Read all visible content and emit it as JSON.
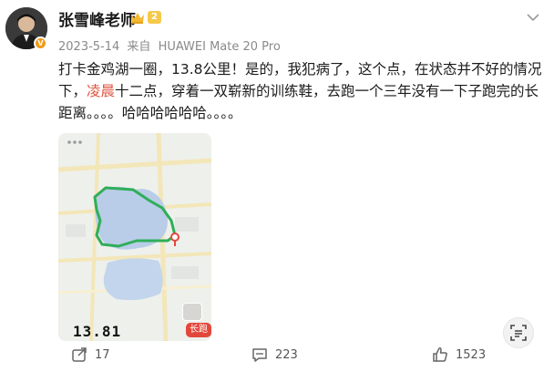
{
  "author": {
    "name": "张雪峰老师",
    "level_badge": "2"
  },
  "meta": {
    "date": "2023-5-14",
    "source_prefix": "来自",
    "device": "HUAWEI Mate 20 Pro"
  },
  "post": {
    "text_before_highlight": "打卡金鸡湖一圈，13.8公里！是的，我犯病了，这个点，在状态并不好的情况下，",
    "highlight": "凌晨",
    "text_after_highlight": "十二点，穿着一双崭新的训练鞋，去跑一个三年没有一下子跑完的长距离。。。。哈哈哈哈哈哈。。。。"
  },
  "map_card": {
    "distance": "13.81",
    "app_tag": "长跑",
    "route_color": "#2fae58",
    "endpoint_color": "#e2473b",
    "water_color": "#b9cde8",
    "road_color": "#f3e6b8"
  },
  "actions": {
    "repost_count": "17",
    "comment_count": "223",
    "like_count": "1523"
  },
  "icons": {
    "scan": "scan-text-icon",
    "more": "chevron-down-icon",
    "repost": "repost-icon",
    "comment": "comment-icon",
    "like": "thumbs-up-icon"
  }
}
